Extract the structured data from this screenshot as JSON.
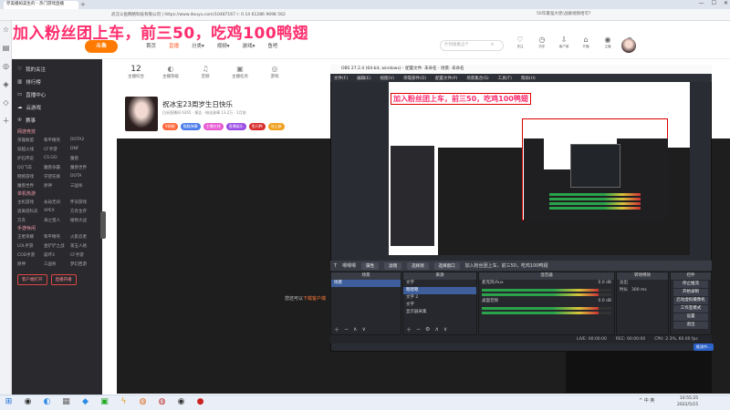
{
  "browser": {
    "tab_title": "存美播如美生的 - 热门游戏直播",
    "url": "武汉斗鱼网络科技有限公司 | https://www.douyu.com/10487167 r: 0.14 61286 9698 562",
    "promo": "50年最强大佬(战群视频哈可?"
  },
  "overlay_title": "加入粉丝团上车，前三50，吃鸡100鸭翅",
  "douyu": {
    "logo": "斗鱼",
    "nav": [
      "首页",
      "直播",
      "分类▾",
      "视频▾",
      "游戏▾",
      "鱼吧"
    ],
    "search_placeholder": "什热搜素这个",
    "top_icons": [
      {
        "icon": "bell-icon",
        "label": "关注"
      },
      {
        "icon": "history-icon",
        "label": "历史"
      },
      {
        "icon": "download-icon",
        "label": "客户端"
      },
      {
        "icon": "gift-icon",
        "label": "开播"
      },
      {
        "icon": "live-icon",
        "label": "主播"
      },
      {
        "icon": "cart-icon",
        "label": "充值"
      }
    ],
    "left_menu": [
      "我的关注",
      "排行榜",
      "直播中心",
      "云游戏",
      "赛事"
    ],
    "left_section_1": "网游竞技",
    "left_grid_1": [
      "英雄联盟",
      "和平精英",
      "DOTA2",
      "穿越火线",
      "CF手游",
      "DNF",
      "炉石传说",
      "CS:GO",
      "魔兽",
      "QQ飞车",
      "魔兽争霸",
      "魔兽世界",
      "网络游戏",
      "守望先锋",
      "DOTA",
      "魔兽世界",
      "原神",
      "三国杀"
    ],
    "left_section_2": "单机热游",
    "left_grid_2": [
      "主机游戏",
      "永劫无间",
      "怀旧游戏",
      "逃离塔科夫",
      "APEX",
      "方舟生存",
      "方舟",
      "海之猎人",
      "植物大战"
    ],
    "left_section_3": "手游休闲",
    "left_grid_3": [
      "王者荣耀",
      "和平精英",
      "火影忍者",
      "LOL手游",
      "金铲铲之战",
      "第五人格",
      "COD手游",
      "崩坏3",
      "CF手游",
      "原神",
      "三国杀",
      "梦幻西游"
    ],
    "left_buttons": [
      "客户端打开",
      "直播开播"
    ],
    "stats": [
      {
        "value": "12",
        "label": "主播综合"
      },
      {
        "value": "",
        "label": "主播等级"
      },
      {
        "value": "",
        "label": "音频"
      },
      {
        "value": "",
        "label": "主播任务"
      },
      {
        "value": "",
        "label": "游戏"
      }
    ],
    "streamer_name": "祝冰宝23周岁生日快乐",
    "streamer_meta": "白米直播间 6265 · 报告 · 粉丝勋章 13.2万 · 1月前",
    "streamer_tags": [
      "V网络",
      "猫猫弹幕",
      "主播在线",
      "直播娱乐",
      "鱼闪鸭",
      "冰上新"
    ],
    "video_caption_prefix": "您还可以",
    "video_caption_link": "下载客户端"
  },
  "obs": {
    "title": "OBS 27.2.4 (64-bit, windows) - 配置文件: 未命名 - 场景: 未命名",
    "menu": [
      "文件(F)",
      "编辑(E)",
      "视图(V)",
      "停靠部件(D)",
      "配置文件(P)",
      "场景集合(S)",
      "工具(T)",
      "帮助(H)"
    ],
    "inner_title": "加入粉丝团上车，前三50，吃鸡100鸭翅",
    "source_bar": {
      "source": "嗯嗯嗯",
      "props": "属性",
      "filters": "滤镜",
      "select": "选择源",
      "window_btn": "选择窗口",
      "text": "加入粉丝团上车，前三50，吃鸡100鸭翅"
    },
    "docks": {
      "scenes": {
        "title": "场景",
        "items": [
          "场景"
        ]
      },
      "sources": {
        "title": "来源",
        "items": [
          "文字",
          "嗯嗯嗯",
          "文字 2",
          "文字",
          "显示器采集"
        ]
      },
      "mixer": {
        "title": "混音器",
        "channels": [
          {
            "name": "麦克风/Aux",
            "db": "0.0 dB"
          },
          {
            "name": "桌面音频",
            "db": "0.0 dB"
          }
        ]
      },
      "transitions": {
        "title": "转场特效",
        "type": "淡出",
        "duration_label": "时长",
        "duration": "300 ms"
      },
      "controls": {
        "title": "控件",
        "buttons": [
          "停止推流",
          "开始录制",
          "启动虚拟摄像机",
          "工作室模式",
          "设置",
          "退出"
        ]
      }
    },
    "status": {
      "live": "LIVE: 00:00:00",
      "rec": "REC: 00:00:00",
      "cpu": "CPU: 2.3%, 60.00 fps"
    },
    "status_badge": "推流中..."
  },
  "taskbar": {
    "time": "10:55:25",
    "date": "2022/5/15",
    "tray": "^ 中 英"
  }
}
